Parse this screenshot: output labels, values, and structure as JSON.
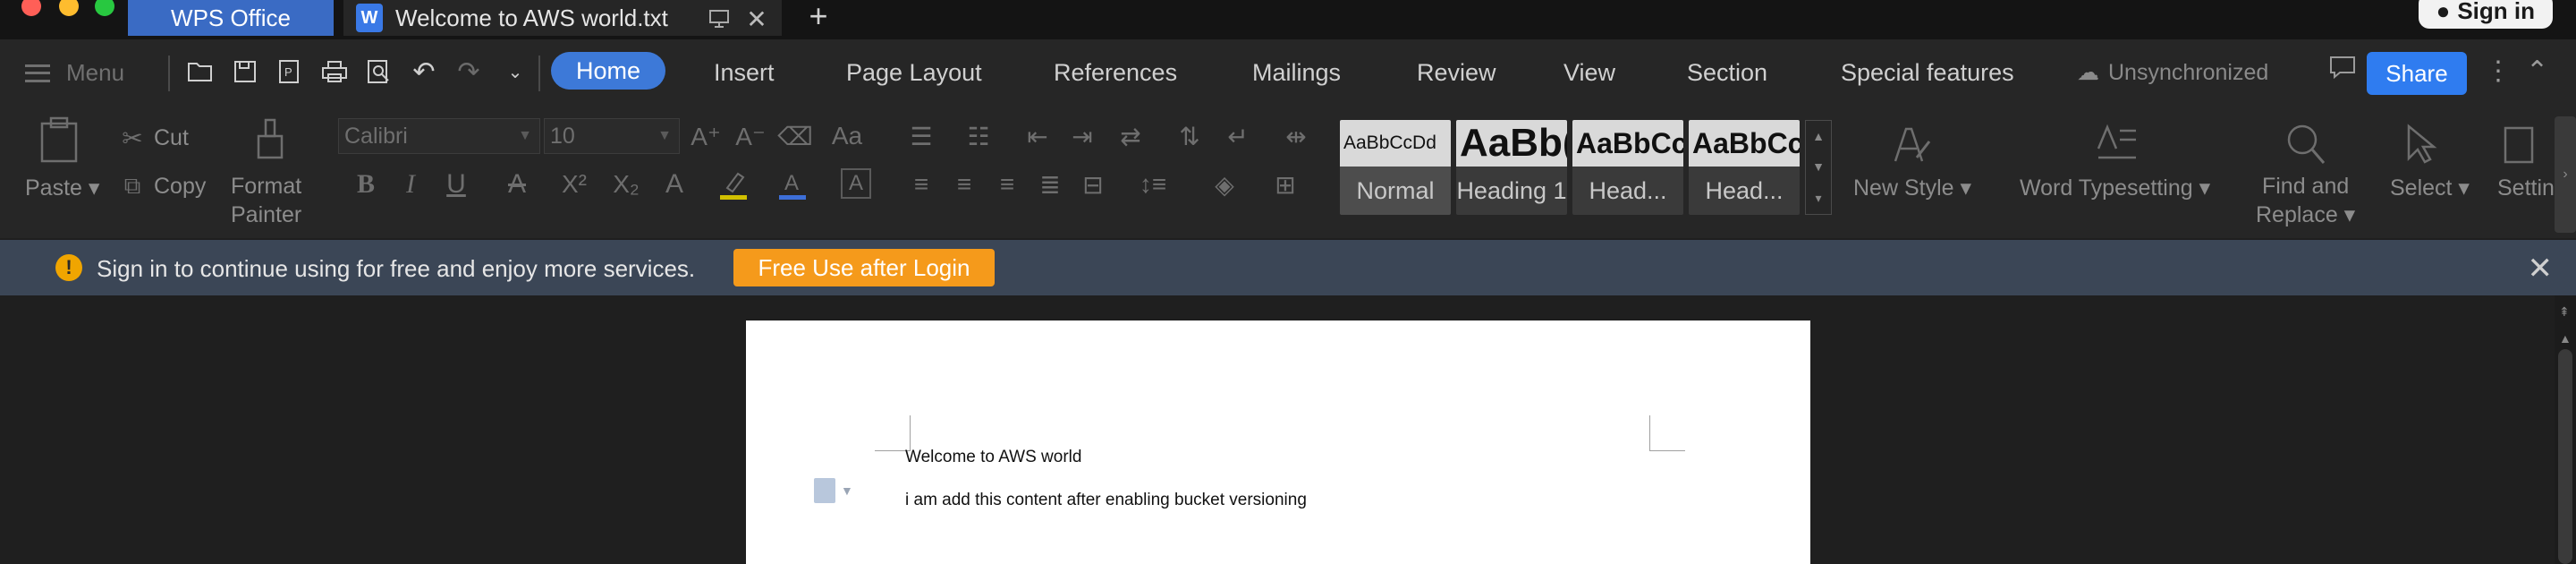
{
  "window": {
    "tabs": [
      {
        "label": "WPS Office"
      },
      {
        "label": "Welcome  to AWS world.txt"
      }
    ],
    "signin_label": "Sign in"
  },
  "menu": {
    "menu_label": "Menu",
    "tabs": [
      "Home",
      "Insert",
      "Page Layout",
      "References",
      "Mailings",
      "Review",
      "View",
      "Section",
      "Special features"
    ],
    "active_tab": "Home",
    "sync_status": "Unsynchronized",
    "share_label": "Share"
  },
  "ribbon": {
    "paste": "Paste",
    "cut": "Cut",
    "copy": "Copy",
    "format_painter_1": "Format",
    "format_painter_2": "Painter",
    "font_name": "Calibri",
    "font_size": "10",
    "styles": [
      {
        "preview": "AaBbCcDd",
        "label": "Normal"
      },
      {
        "preview": "AaBb(",
        "label": "Heading 1"
      },
      {
        "preview": "AaBbCc",
        "label": "Head..."
      },
      {
        "preview": "AaBbCc",
        "label": "Head..."
      }
    ],
    "new_style": "New Style",
    "word_typesetting": "Word Typesetting",
    "find_replace_1": "Find and",
    "find_replace_2": "Replace",
    "select": "Select",
    "settings": "Settin"
  },
  "notice": {
    "text": "Sign in to continue using for free and enjoy more services.",
    "button": "Free Use after Login"
  },
  "document": {
    "lines": [
      "Welcome  to AWS world",
      "i am add this content after enabling bucket versioning"
    ]
  },
  "colors": {
    "accent": "#3d79d8",
    "share": "#2f7cf0",
    "wps_tab": "#3a6bc4",
    "notice_bg": "#3b4656",
    "notice_button": "#f59a1b"
  }
}
